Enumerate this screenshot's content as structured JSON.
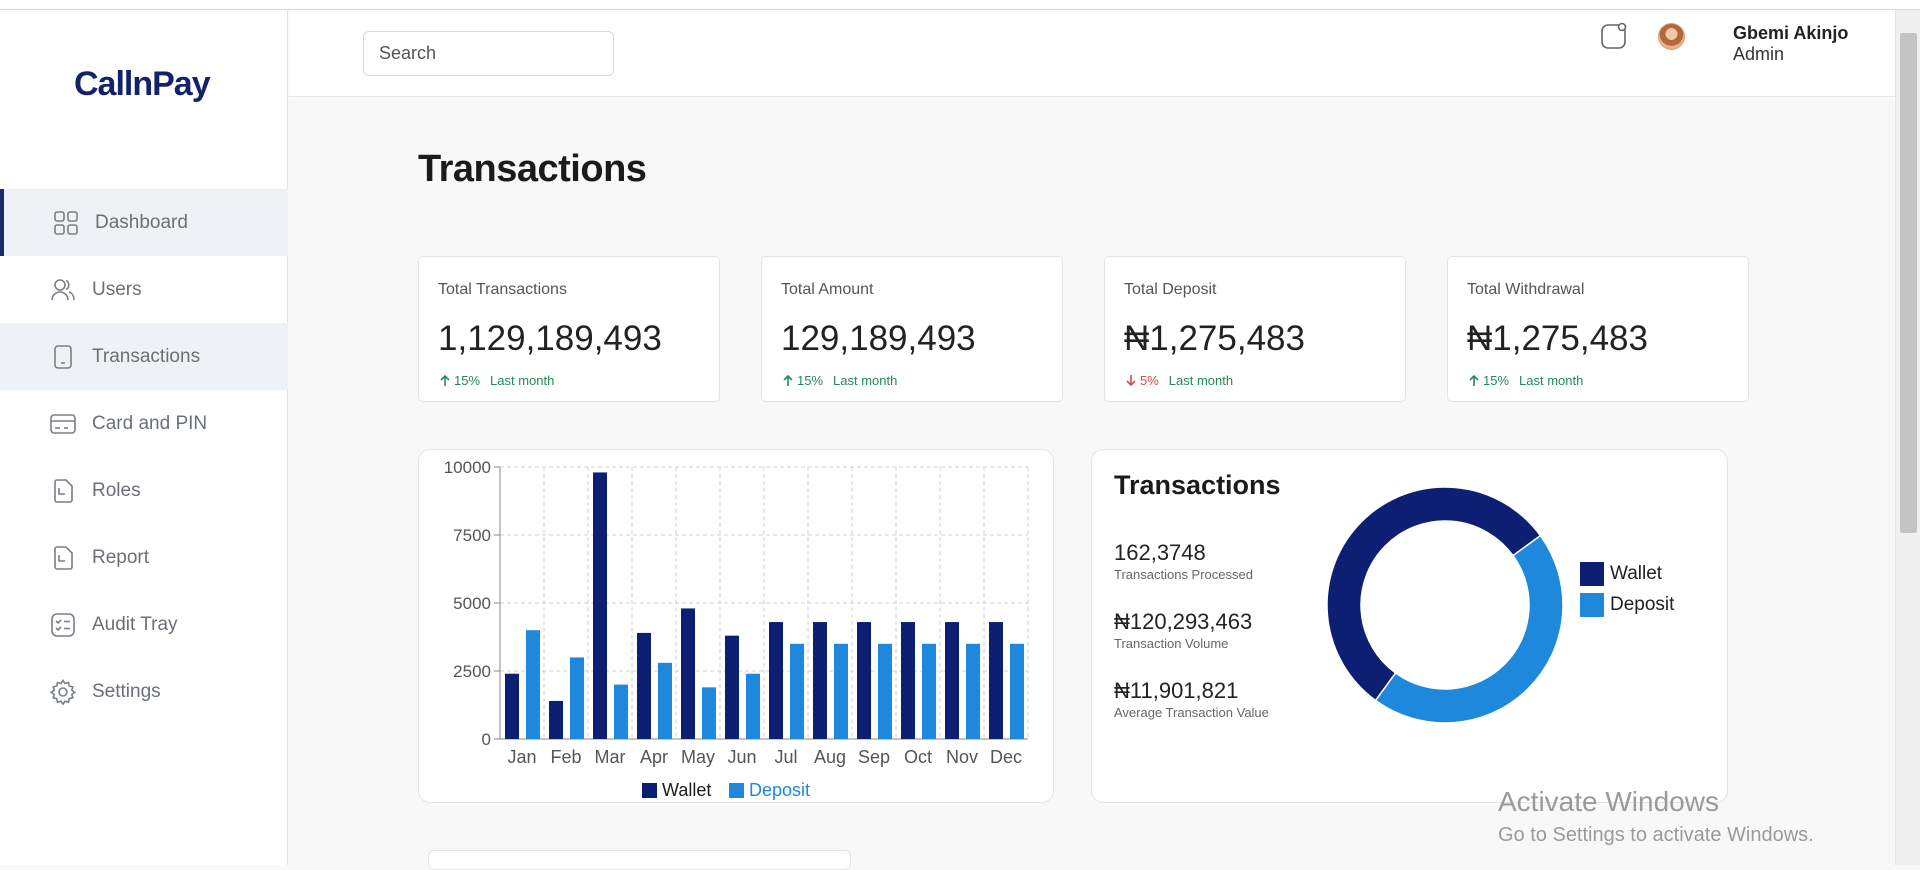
{
  "brand": {
    "logo": "CallnPay"
  },
  "sidebar": {
    "items": [
      {
        "label": "Dashboard",
        "icon": "grid-icon"
      },
      {
        "label": "Users",
        "icon": "users-icon"
      },
      {
        "label": "Transactions",
        "icon": "phone-icon"
      },
      {
        "label": "Card and PIN",
        "icon": "card-icon"
      },
      {
        "label": "Roles",
        "icon": "document-icon"
      },
      {
        "label": "Report",
        "icon": "report-icon"
      },
      {
        "label": "Audit Tray",
        "icon": "checklist-icon"
      },
      {
        "label": "Settings",
        "icon": "gear-icon"
      }
    ]
  },
  "header": {
    "search_placeholder": "Search",
    "user_name": "Gbemi Akinjo",
    "user_role": "Admin"
  },
  "page": {
    "title": "Transactions"
  },
  "cards": [
    {
      "label": "Total Transactions",
      "value": "1,129,189,493",
      "direction": "up",
      "pct": "15%",
      "period": "Last month"
    },
    {
      "label": "Total Amount",
      "value": "129,189,493",
      "direction": "up",
      "pct": "15%",
      "period": "Last month"
    },
    {
      "label": "Total Deposit",
      "value": "₦1,275,483",
      "direction": "down",
      "pct": "5%",
      "period": "Last month"
    },
    {
      "label": "Total Withdrawal",
      "value": "₦1,275,483",
      "direction": "up",
      "pct": "15%",
      "period": "Last month"
    }
  ],
  "donut_panel": {
    "title": "Transactions",
    "stats": [
      {
        "value": "162,3748",
        "label": "Transactions Processed"
      },
      {
        "value": "₦120,293,463",
        "label": "Transaction Volume"
      },
      {
        "value": "₦11,901,821",
        "label": "Average Transaction Value"
      }
    ]
  },
  "colors": {
    "wallet": "#0d1f73",
    "deposit": "#1e88dc",
    "brand": "#13226b",
    "up": "#21895a",
    "down": "#d94a4a"
  },
  "chart_data": [
    {
      "type": "bar",
      "categories": [
        "Jan",
        "Feb",
        "Mar",
        "Apr",
        "May",
        "Jun",
        "Jul",
        "Aug",
        "Sep",
        "Oct",
        "Nov",
        "Dec"
      ],
      "series": [
        {
          "name": "Wallet",
          "values": [
            2400,
            1400,
            9800,
            3900,
            4800,
            3800,
            4300,
            4300,
            4300,
            4300,
            4300,
            4300
          ]
        },
        {
          "name": "Deposit",
          "values": [
            4000,
            3000,
            2000,
            2800,
            1900,
            2400,
            3500,
            3500,
            3500,
            3500,
            3500,
            3500
          ]
        }
      ],
      "yticks": [
        "0",
        "2500",
        "5000",
        "7500",
        "10000"
      ],
      "ylim": [
        0,
        10000
      ],
      "grid": true,
      "legend": "bottom"
    },
    {
      "type": "pie",
      "donut": true,
      "categories": [
        "Wallet",
        "Deposit"
      ],
      "values": [
        55,
        45
      ],
      "legend": "right"
    }
  ],
  "watermark": {
    "line1": "Activate Windows",
    "line2": "Go to Settings to activate Windows."
  }
}
